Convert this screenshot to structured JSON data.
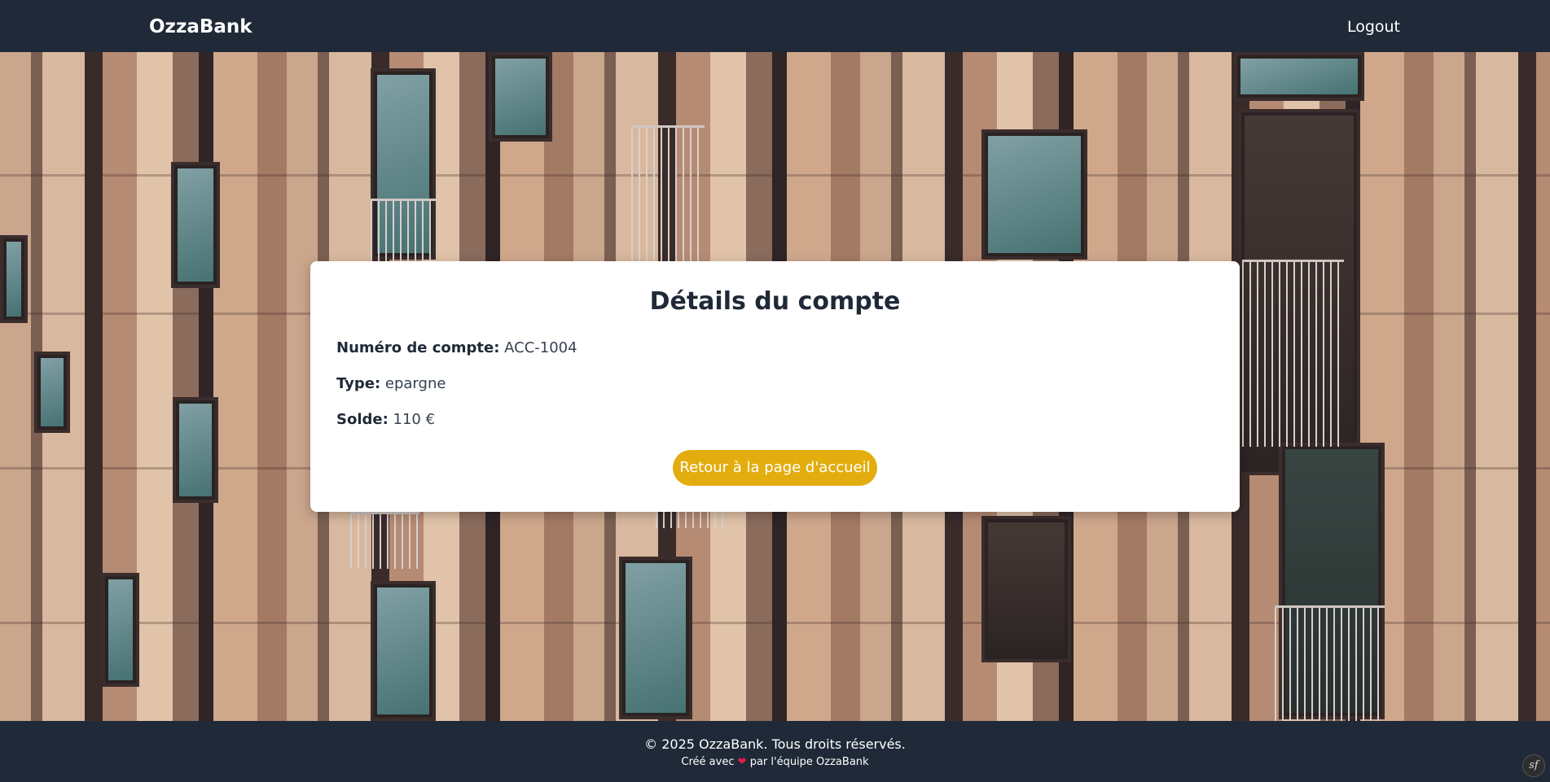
{
  "navbar": {
    "brand": "OzzaBank",
    "logout_label": "Logout"
  },
  "account": {
    "title": "Détails du compte",
    "number_label": "Numéro de compte:",
    "number_value": "ACC-1004",
    "type_label": "Type:",
    "type_value": "epargne",
    "balance_label": "Solde:",
    "balance_value": "110 €",
    "back_button_label": "Retour à la page d'accueil"
  },
  "footer": {
    "copyright": "© 2025 OzzaBank. Tous droits réservés.",
    "made_prefix": "Créé avec",
    "heart_icon": "heart-icon",
    "made_suffix": "par l'équipe OzzaBank"
  },
  "debug_toolbar": {
    "icon": "symfony-icon",
    "label": "sf"
  },
  "colors": {
    "header_bg": "#1f2937",
    "accent": "#e3ad0f",
    "card_bg": "#ffffff",
    "heart": "#e11d48"
  }
}
